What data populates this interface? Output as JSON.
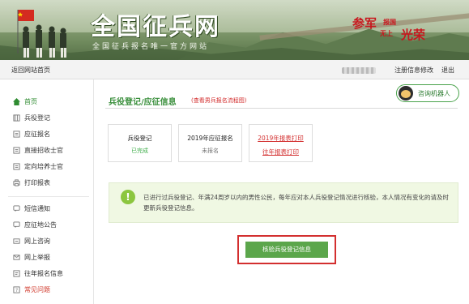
{
  "header": {
    "logo_title": "全国征兵网",
    "logo_subtitle": "全国征兵报名唯一官方网站",
    "slogan": {
      "part1": "参军",
      "part2": "报国",
      "part3": "无上",
      "part4": "光荣"
    }
  },
  "navbar": {
    "home_link": "返回网站首页",
    "register_edit": "注册信息修改",
    "logout": "退出"
  },
  "sidebar": {
    "items": [
      {
        "label": "首页",
        "icon": "home-icon",
        "state": "active"
      },
      {
        "label": "兵役登记",
        "icon": "register-icon"
      },
      {
        "label": "应征报名",
        "icon": "form-icon"
      },
      {
        "label": "直接招收士官",
        "icon": "form-icon"
      },
      {
        "label": "定向培养士官",
        "icon": "form-icon"
      },
      {
        "label": "打印报表",
        "icon": "print-icon"
      },
      {
        "label": "短信通知",
        "icon": "message-icon"
      },
      {
        "label": "应征地公告",
        "icon": "message-icon"
      },
      {
        "label": "网上咨询",
        "icon": "chat-icon"
      },
      {
        "label": "网上举报",
        "icon": "report-icon"
      },
      {
        "label": "往年报名信息",
        "icon": "history-icon"
      },
      {
        "label": "常见问题",
        "icon": "question-icon",
        "state": "highlight"
      }
    ]
  },
  "main": {
    "title": "兵役登记/应征信息",
    "flow_link": "(查看男兵报名流程图)",
    "robot_button": "咨询机器人",
    "cards": [
      {
        "title": "兵役登记",
        "status": "已完成"
      },
      {
        "title": "2019年应征报名",
        "status": "未报名"
      },
      {
        "link1": "2019年报表打印",
        "link2": "往年报表打印"
      }
    ],
    "notice": "已进行过兵役登记、年满24周岁以内的男性公民，每年应对本人兵役登记情况进行核验，本人情况有变化的请及时更新兵役登记信息。",
    "verify_button": "核验兵役登记信息"
  },
  "colors": {
    "accent_green": "#3a8f3c",
    "highlight_red": "#d32f2f",
    "notice_bg": "#f0f8e3"
  }
}
